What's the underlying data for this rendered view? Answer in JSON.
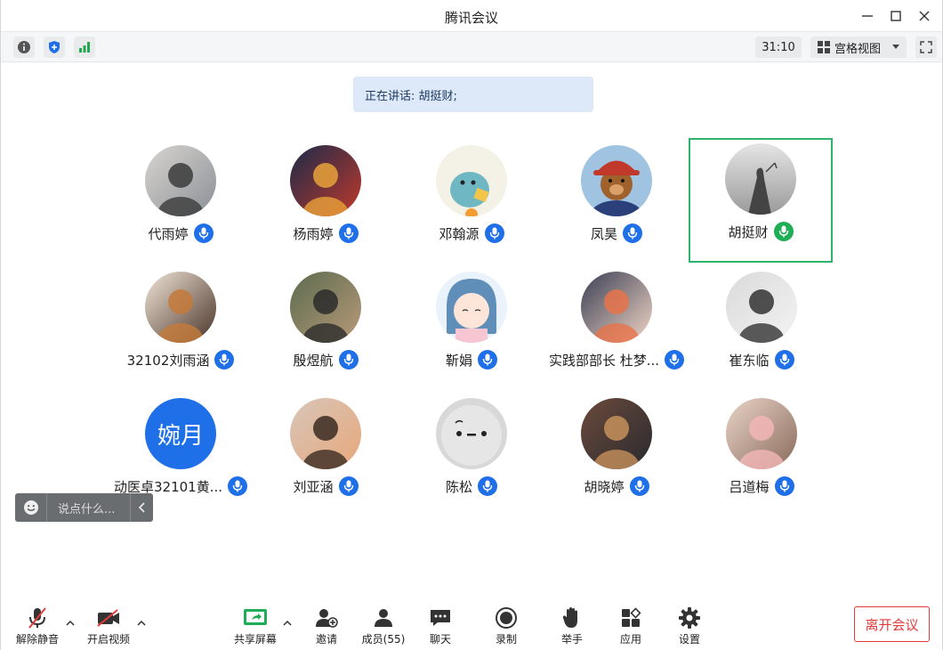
{
  "window": {
    "title": "腾讯会议"
  },
  "toolbar": {
    "timer": "31:10",
    "view_label": "宫格视图"
  },
  "speaking": {
    "text": "正在讲话: 胡挺财;"
  },
  "participants": [
    {
      "name": "代雨婷",
      "mic": "blue",
      "avatar": {
        "kind": "photo",
        "colors": [
          "#d9d5d0",
          "#3b3b3b",
          "#8a8f96"
        ]
      }
    },
    {
      "name": "杨雨婷",
      "mic": "blue",
      "avatar": {
        "kind": "photo",
        "colors": [
          "#1b2a4a",
          "#e8a23a",
          "#c0392b"
        ]
      }
    },
    {
      "name": "邓翰源",
      "mic": "blue",
      "avatar": {
        "kind": "cartoon-dino",
        "colors": [
          "#f4f1e6",
          "#6fb7c3",
          "#f3c64a"
        ]
      }
    },
    {
      "name": "凤昊",
      "mic": "blue",
      "avatar": {
        "kind": "bear",
        "colors": [
          "#9fc3e0",
          "#a0622d",
          "#c0392b"
        ]
      }
    },
    {
      "name": "胡挺财",
      "mic": "green",
      "active": true,
      "avatar": {
        "kind": "silhouette",
        "colors": [
          "#e5e5e5",
          "#9a9a9a",
          "#444444"
        ]
      }
    },
    {
      "name": "32102刘雨涵",
      "mic": "blue",
      "avatar": {
        "kind": "anime",
        "colors": [
          "#f1e6d8",
          "#c47a3a",
          "#4a3328"
        ]
      }
    },
    {
      "name": "殷煜航",
      "mic": "blue",
      "avatar": {
        "kind": "photo",
        "colors": [
          "#5b6b4e",
          "#2c2c2c",
          "#b89a7a"
        ]
      }
    },
    {
      "name": "靳娟",
      "mic": "blue",
      "avatar": {
        "kind": "cartoon-girl",
        "colors": [
          "#eaf2fb",
          "#5f8fb8",
          "#f6c7d2"
        ]
      }
    },
    {
      "name": "实践部部长 杜梦...",
      "mic": "blue",
      "avatar": {
        "kind": "anime-boy",
        "colors": [
          "#3a3f55",
          "#e8734a",
          "#f2d6c5"
        ]
      }
    },
    {
      "name": "崔东临",
      "mic": "blue",
      "avatar": {
        "kind": "portrait",
        "colors": [
          "#dadada",
          "#333333",
          "#f3f3f3"
        ]
      }
    },
    {
      "name": "动医卓32101黄...",
      "mic": "blue",
      "avatar": {
        "kind": "text",
        "text": "婉月",
        "colors": [
          "#1e6fe8"
        ]
      }
    },
    {
      "name": "刘亚涵",
      "mic": "blue",
      "avatar": {
        "kind": "photo",
        "colors": [
          "#d7c5b8",
          "#3b2a22",
          "#e8a87c"
        ]
      }
    },
    {
      "name": "陈松",
      "mic": "blue",
      "avatar": {
        "kind": "plush",
        "colors": [
          "#d8d8d8",
          "#222222"
        ]
      }
    },
    {
      "name": "胡晓婷",
      "mic": "blue",
      "avatar": {
        "kind": "painting",
        "colors": [
          "#6b4a3a",
          "#c7905a",
          "#2a2a30"
        ]
      }
    },
    {
      "name": "吕道梅",
      "mic": "blue",
      "avatar": {
        "kind": "hamster",
        "colors": [
          "#e9d5c8",
          "#f2b6b6",
          "#8a6a5a"
        ]
      }
    }
  ],
  "chat": {
    "placeholder": "说点什么..."
  },
  "bottom": {
    "unmute": "解除静音",
    "video": "开启视频",
    "share": "共享屏幕",
    "invite": "邀请",
    "members": "成员(55)",
    "chat": "聊天",
    "record": "录制",
    "raise_hand": "举手",
    "apps": "应用",
    "settings": "设置",
    "leave": "离开会议"
  },
  "colors": {
    "accent": "#1e6fe8",
    "speaking": "#1fad55",
    "leave": "#e53a3a"
  }
}
